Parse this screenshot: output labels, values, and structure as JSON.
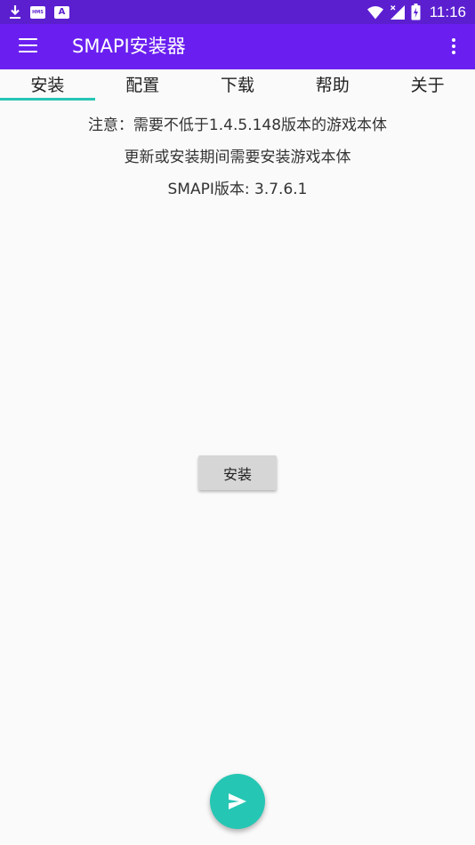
{
  "status_bar": {
    "time": "11:16",
    "hms_badge": "HMS",
    "a_badge": "A"
  },
  "app_bar": {
    "title": "SMAPI安装器"
  },
  "tabs": [
    {
      "label": "安装",
      "active": true
    },
    {
      "label": "配置",
      "active": false
    },
    {
      "label": "下载",
      "active": false
    },
    {
      "label": "帮助",
      "active": false
    },
    {
      "label": "关于",
      "active": false
    }
  ],
  "content": {
    "notice": "注意：需要不低于1.4.5.148版本的游戏本体",
    "install_hint": "更新或安装期间需要安装游戏本体",
    "smapi_version": "SMAPI版本: 3.7.6.1",
    "install_button": "安装"
  },
  "colors": {
    "status_bar": "#5b1fd0",
    "app_bar": "#6a1ff0",
    "accent": "#26c6b4",
    "background": "#fafafa"
  },
  "icons": {
    "status_left": [
      "download-icon",
      "hms-icon",
      "a-icon"
    ],
    "status_right": [
      "wifi-icon",
      "signal-icon",
      "battery-icon"
    ],
    "app_bar_left": "menu-icon",
    "app_bar_right": "overflow-menu-icon",
    "fab": "send-icon"
  }
}
